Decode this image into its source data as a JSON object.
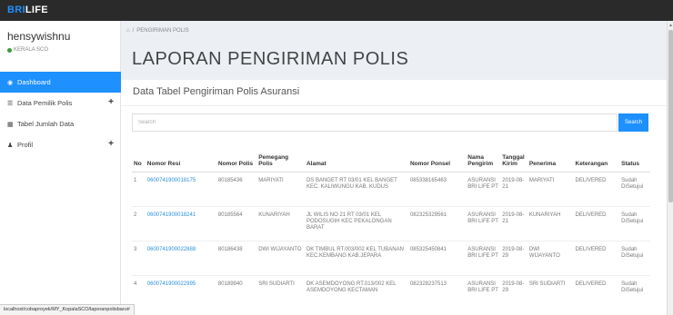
{
  "app": {
    "brand_part1": "BRI",
    "brand_part2": "LIFE"
  },
  "user": {
    "name": "hensywishnu",
    "status": "KERALA SCO"
  },
  "sidebar": {
    "items": [
      {
        "icon": "dashboard-icon",
        "label": "Dashboard",
        "active": true
      },
      {
        "icon": "list-icon",
        "label": "Data Pemilik Polis",
        "expandable": true
      },
      {
        "icon": "calendar-icon",
        "label": "Tabel Jumlah Data"
      },
      {
        "icon": "user-icon",
        "label": "Profil",
        "expandable": true
      }
    ]
  },
  "breadcrumb": {
    "home_icon": "home-icon",
    "current": "PENGIRIMAN POLIS"
  },
  "page": {
    "title": "LAPORAN PENGIRIMAN POLIS"
  },
  "panel": {
    "title": "Data Tabel Pengiriman Polis Asuransi"
  },
  "search": {
    "placeholder": "Search",
    "button_label": "Search"
  },
  "table": {
    "headers": {
      "no": "No",
      "resi": "Nomor Resi",
      "polis": "Nomor Polis",
      "pemegang": "Pemegang Polis",
      "alamat": "Alamat",
      "ponsel": "Nomor Ponsel",
      "pengirim": "Nama Pengirim",
      "tanggal": "Tanggal Kirim",
      "penerima": "Penerima",
      "keterangan": "Keterangan",
      "status": "Status"
    },
    "rows": [
      {
        "no": "1",
        "resi": "0600741900018175",
        "polis": "80185436",
        "pemegang": "MARIYATI",
        "alamat": "DS BANGET RT 03/01 KEL BANGET KEC. KALIWUNGU KAB. KUDUS",
        "ponsel": "085338165463",
        "pengirim": "ASURANSI BRI LIFE PT",
        "tanggal": "2019-08-21",
        "penerima": "MARIYATI",
        "keterangan": "DELIVERED",
        "status": "Sudah DiSetujui"
      },
      {
        "no": "2",
        "resi": "0600741900018241",
        "polis": "80185564",
        "pemegang": "KUNARIYAH",
        "alamat": "JL WILIS NO 21 RT 03/01 KEL PODOSUGIH KEC PEKALONGAN BARAT",
        "ponsel": "082325329561",
        "pengirim": "ASURANSI BRI LIFE PT",
        "tanggal": "2019-08-21",
        "penerima": "KUNARIYAH",
        "keterangan": "DELIVERED",
        "status": "Sudah DiSetujui"
      },
      {
        "no": "3",
        "resi": "0600741900022888",
        "polis": "80186438",
        "pemegang": "DWI WIJAYANTO",
        "alamat": "DK TIMBUL RT.003/002 KEL TUBANAN KEC.KEMBANG KAB.JEPARA",
        "ponsel": "085325450841",
        "pengirim": "ASURANSI BRI LIFE PT",
        "tanggal": "2019-08-29",
        "penerima": "DWI WIJAYANTO",
        "keterangan": "DELIVERED",
        "status": "Sudah DiSetujui"
      },
      {
        "no": "4",
        "resi": "0600741900022995",
        "polis": "80189940",
        "pemegang": "SRI SUDIARTI",
        "alamat": "DK ASEMDOYONG RT.013/002 KEL ASEMDOYONG KECTAMAN",
        "ponsel": "082328237513",
        "pengirim": "ASURANSI BRI LIFE PT",
        "tanggal": "2019-08-29",
        "penerima": "SRI SUDIARTI",
        "keterangan": "DELIVERED",
        "status": "Sudah DiSetujui"
      }
    ]
  },
  "status_bar": {
    "url": "localhost/cobaproyek/MY_KopalaSCO/laporanpolisbaru#"
  },
  "colors": {
    "accent": "#1e90ff",
    "topbar": "#2a2a2a",
    "link": "#2a8fd8",
    "online": "#3c9e3c"
  }
}
